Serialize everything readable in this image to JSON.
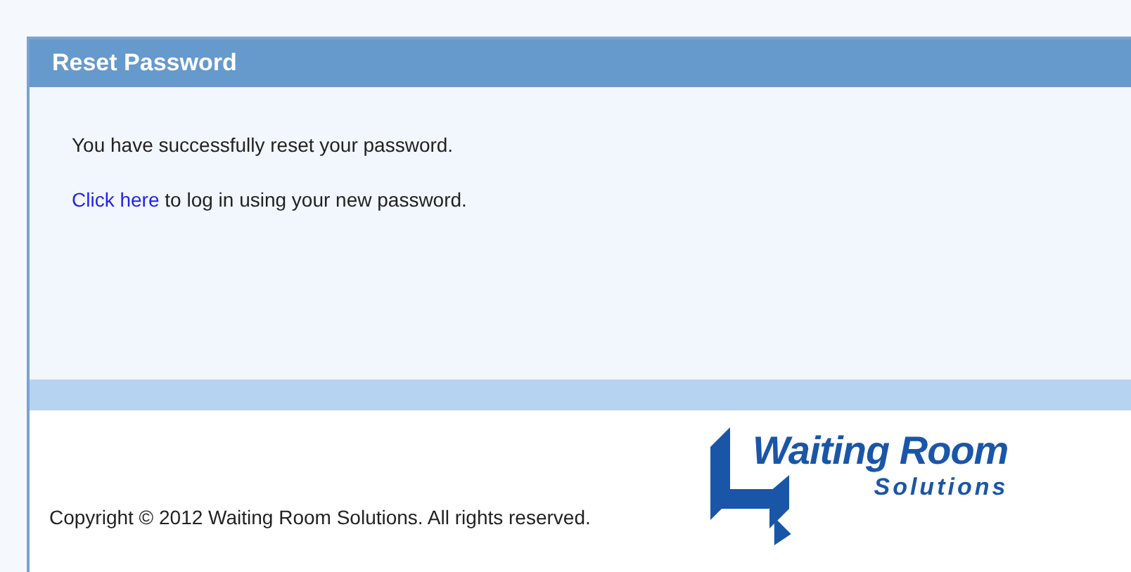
{
  "panel": {
    "title": "Reset Password",
    "message": "You have successfully reset your password.",
    "login_prompt": {
      "link": "Click here",
      "text": " to log in using your new password."
    }
  },
  "footer": {
    "copyright": "Copyright © 2012 Waiting Room Solutions. All rights reserved.",
    "logo": {
      "name": "Waiting Room",
      "tagline": "Solutions"
    }
  }
}
